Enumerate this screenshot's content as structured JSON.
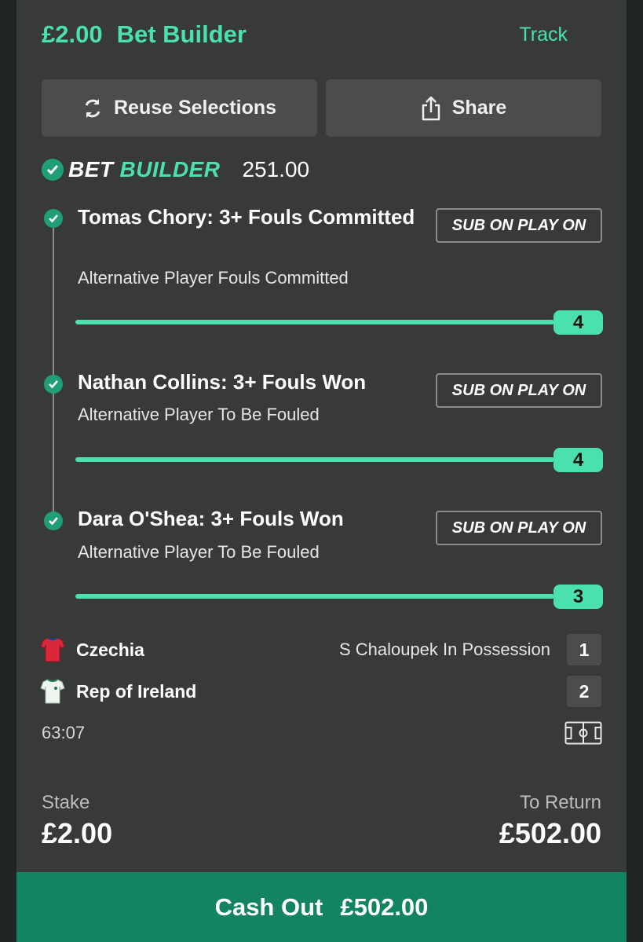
{
  "header": {
    "stake_amount": "£2.00",
    "bet_type": "Bet Builder",
    "track_label": "Track"
  },
  "actions": {
    "reuse_label": "Reuse Selections",
    "share_label": "Share"
  },
  "bet_builder": {
    "word1": "BET",
    "word2": "BUILDER",
    "odds": "251.00"
  },
  "legs": [
    {
      "title": "Tomas Chory: 3+ Fouls Committed",
      "subtitle": "Alternative Player Fouls Committed",
      "badge": "SUB ON PLAY ON",
      "progress_value": "4",
      "progress_fraction": 1.0
    },
    {
      "title": "Nathan Collins: 3+ Fouls Won",
      "subtitle": "Alternative Player To Be Fouled",
      "badge": "SUB ON PLAY ON",
      "progress_value": "4",
      "progress_fraction": 1.0
    },
    {
      "title": "Dara O'Shea: 3+ Fouls Won",
      "subtitle": "Alternative Player To Be Fouled",
      "badge": "SUB ON PLAY ON",
      "progress_value": "3",
      "progress_fraction": 1.0
    }
  ],
  "match": {
    "home_team": "Czechia",
    "home_score": "1",
    "away_team": "Rep of Ireland",
    "away_score": "2",
    "possession": "S Chaloupek In Possession",
    "clock": "63:07"
  },
  "totals": {
    "stake_label": "Stake",
    "stake_value": "£2.00",
    "return_label": "To Return",
    "return_value": "£502.00"
  },
  "cashout": {
    "label": "Cash Out",
    "amount": "£502.00"
  },
  "colors": {
    "accent": "#4be0b0",
    "cashout_bg": "#138462",
    "card_bg": "#373a39"
  }
}
